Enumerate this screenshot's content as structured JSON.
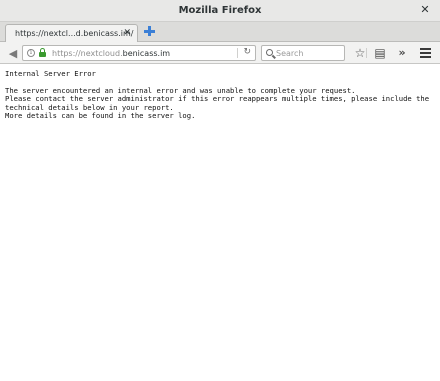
{
  "window": {
    "title": "Mozilla Firefox"
  },
  "tabs": [
    {
      "label": "https://nextcl...d.benicass.im/"
    }
  ],
  "navbar": {
    "url_prefix": "https://nextcloud.",
    "url_domain": "benicass.im",
    "search_placeholder": "Search"
  },
  "page": {
    "heading": "Internal Server Error",
    "paragraph_1": "The server encountered an internal error and was unable to complete your request.",
    "paragraph_2": "Please contact the server administrator if this error reappears multiple times, please include the technical details below in your report.",
    "paragraph_3": "More details can be found in the server log."
  },
  "icons": {
    "close": "close-icon",
    "tab_close": "close-icon",
    "new_tab": "plus-icon",
    "back": "back-arrow-icon",
    "info": "info-icon",
    "lock": "lock-icon",
    "reload": "reload-icon",
    "search": "search-icon",
    "bookmark": "star-icon",
    "library": "library-icon",
    "overflow": "chevron-double-right-icon",
    "menu": "hamburger-menu-icon"
  },
  "colors": {
    "lock": "#3a9a2f",
    "new_tab": "#3b7fd6"
  }
}
